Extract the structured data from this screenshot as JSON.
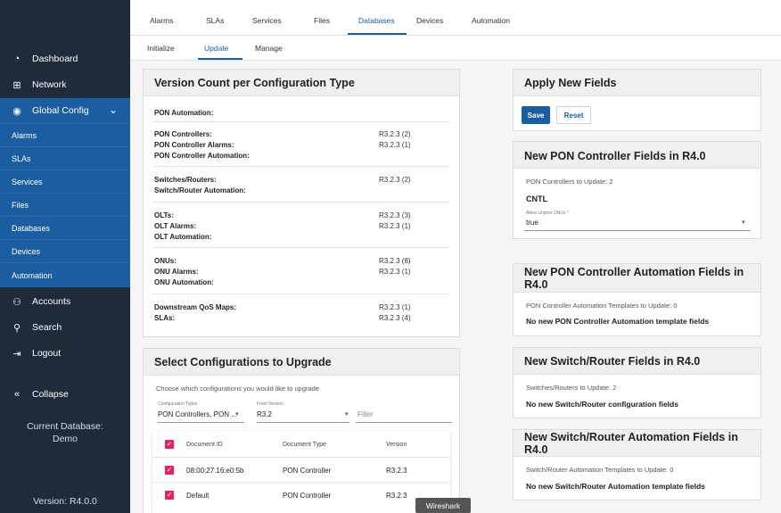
{
  "sidebar": {
    "items": [
      {
        "label": "Dashboard",
        "icon": "dashboard-icon"
      },
      {
        "label": "Network",
        "icon": "network-icon"
      },
      {
        "label": "Global Config",
        "icon": "globe-icon"
      },
      {
        "label": "Accounts",
        "icon": "accounts-icon"
      },
      {
        "label": "Search",
        "icon": "search-icon"
      },
      {
        "label": "Logout",
        "icon": "logout-icon"
      }
    ],
    "sub_items": [
      "Alarms",
      "SLAs",
      "Services",
      "Files",
      "Databases",
      "Devices",
      "Automation"
    ],
    "collapse_label": "Collapse",
    "current_db_label": "Current Database:",
    "current_db_value": "Demo",
    "version": "Version: R4.0.0"
  },
  "top_tabs": [
    "Alarms",
    "SLAs",
    "Services",
    "Files",
    "Databases",
    "Devices",
    "Automation"
  ],
  "active_top_tab": "Databases",
  "sub_tabs": [
    "Initialize",
    "Update",
    "Manage"
  ],
  "active_sub_tab": "Update",
  "version_count": {
    "title": "Version Count per Configuration Type",
    "groups": [
      {
        "rows": [
          {
            "label": "PON Automation:",
            "value": ""
          }
        ]
      },
      {
        "rows": [
          {
            "label": "PON Controllers:",
            "value": "R3.2.3 (2)"
          },
          {
            "label": "PON Controller Alarms:",
            "value": "R3.2.3 (1)"
          },
          {
            "label": "PON Controller Automation:",
            "value": ""
          }
        ]
      },
      {
        "rows": [
          {
            "label": "Switches/Routers:",
            "value": "R3.2.3 (2)"
          },
          {
            "label": "Switch/Router Automation:",
            "value": ""
          }
        ]
      },
      {
        "rows": [
          {
            "label": "OLTs:",
            "value": "R3.2.3 (3)"
          },
          {
            "label": "OLT Alarms:",
            "value": "R3.2.3 (1)"
          },
          {
            "label": "OLT Automation:",
            "value": ""
          }
        ]
      },
      {
        "rows": [
          {
            "label": "ONUs:",
            "value": "R3.2.3 (8)"
          },
          {
            "label": "ONU Alarms:",
            "value": "R3.2.3 (1)"
          },
          {
            "label": "ONU Automation:",
            "value": ""
          }
        ]
      },
      {
        "rows": [
          {
            "label": "Downstream QoS Maps:",
            "value": "R3.2.3 (1)"
          },
          {
            "label": "SLAs:",
            "value": "R3.2.3 (4)"
          }
        ]
      }
    ]
  },
  "select_configs": {
    "title": "Select Configurations to Upgrade",
    "instruction": "Choose which configurations you would like to upgrade",
    "config_types_label": "Configuration Types",
    "config_types_value": "PON Controllers, PON ...",
    "from_version_label": "From Version",
    "from_version_value": "R3.2",
    "filter_placeholder": "Filter",
    "columns": [
      "Document ID",
      "Document Type",
      "Version"
    ],
    "rows": [
      {
        "id": "08:00:27:16:e0:5b",
        "type": "PON Controller",
        "version": "R3.2.3"
      },
      {
        "id": "Default",
        "type": "PON Controller",
        "version": "R3.2.3"
      }
    ]
  },
  "apply": {
    "title": "Apply New Fields",
    "save": "Save",
    "reset": "Reset"
  },
  "pon_fields": {
    "title": "New PON Controller Fields in R4.0",
    "count": "PON Controllers to Update: 2",
    "section": "CNTL",
    "field_label": "Allow Unprov ONUs *",
    "field_value": "true"
  },
  "pon_auto": {
    "title": "New PON Controller Automation Fields in R4.0",
    "count": "PON Controller Automation Templates to Update: 0",
    "message": "No new PON Controller Automation template fields"
  },
  "switch_fields": {
    "title": "New Switch/Router Fields in R4.0",
    "count": "Switches/Routers to Update: 2",
    "message": "No new Switch/Router configuration fields"
  },
  "switch_auto": {
    "title": "New Switch/Router Automation Fields in R4.0",
    "count": "Switch/Router Automation Templates to Update: 0",
    "message": "No new Switch/Router Automation template fields"
  },
  "tooltip": "Wireshark",
  "colors": {
    "sidebar": "#1f2a3a",
    "accent": "#1a5da0",
    "checkbox": "#e91e63"
  }
}
